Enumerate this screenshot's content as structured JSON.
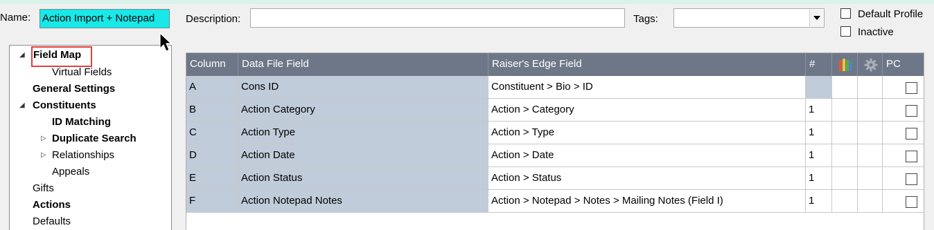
{
  "form": {
    "name_label": "Name:",
    "name_value": "Action Import + Notepad",
    "description_label": "Description:",
    "description_value": "",
    "tags_label": "Tags:",
    "tags_value": "",
    "default_profile_label": "Default Profile",
    "default_profile_checked": false,
    "inactive_label": "Inactive",
    "inactive_checked": false
  },
  "tree": {
    "selected": "Field Map",
    "items": [
      {
        "label": "Field Map",
        "bold": true,
        "expanded": true,
        "has_children": true
      },
      {
        "label": "Virtual Fields",
        "bold": false
      },
      {
        "label": "General Settings",
        "bold": true
      },
      {
        "label": "Constituents",
        "bold": true,
        "expanded": true,
        "has_children": true
      },
      {
        "label": "ID Matching",
        "bold": true
      },
      {
        "label": "Duplicate Search",
        "bold": true,
        "expanded": false,
        "has_children": true
      },
      {
        "label": "Relationships",
        "bold": false,
        "expanded": false,
        "has_children": true
      },
      {
        "label": "Appeals",
        "bold": false
      },
      {
        "label": "Gifts",
        "bold": false
      },
      {
        "label": "Actions",
        "bold": true
      },
      {
        "label": "Defaults",
        "bold": false
      }
    ]
  },
  "grid": {
    "headers": {
      "column": "Column",
      "data_file_field": "Data File Field",
      "raisers_edge_field": "Raiser's Edge Field",
      "count": "#",
      "books_icon": "books-icon",
      "gear_icon": "gear-icon",
      "pc": "PC"
    },
    "rows": [
      {
        "column": "A",
        "data_file_field": "Cons ID",
        "raisers_edge_field": "Constituent > Bio > ID",
        "count": "",
        "pc": false
      },
      {
        "column": "B",
        "data_file_field": "Action Category",
        "raisers_edge_field": "Action > Category",
        "count": "1",
        "pc": false
      },
      {
        "column": "C",
        "data_file_field": "Action Type",
        "raisers_edge_field": "Action > Type",
        "count": "1",
        "pc": false
      },
      {
        "column": "D",
        "data_file_field": "Action Date",
        "raisers_edge_field": "Action > Date",
        "count": "1",
        "pc": false
      },
      {
        "column": "E",
        "data_file_field": "Action Status",
        "raisers_edge_field": "Action > Status",
        "count": "1",
        "pc": false
      },
      {
        "column": "F",
        "data_file_field": "Action Notepad Notes",
        "raisers_edge_field": "Action > Notepad > Notes > Mailing Notes (Field I)",
        "count": "1",
        "pc": false
      }
    ]
  },
  "colors": {
    "name_field_bg": "#18e8e8",
    "grid_header_bg": "#6e7787",
    "grid_mapped_cell_bg": "#c0ccd9",
    "selection_outline": "#e04040"
  }
}
